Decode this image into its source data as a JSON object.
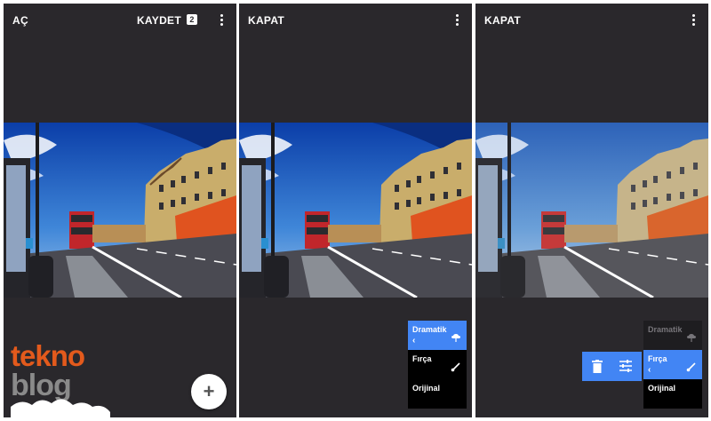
{
  "panels": [
    {
      "left_label": "AÇ",
      "save_label": "KAYDET",
      "badge": "2",
      "more_icon": "more-vert-icon",
      "fab_label": "+",
      "watermark": {
        "line1": "tekno",
        "line2": "blog"
      }
    },
    {
      "left_label": "KAPAT",
      "more_icon": "more-vert-icon",
      "stack": [
        {
          "label": "Dramatik",
          "arrow": "‹",
          "icon": "cloud-icon",
          "style": "blue"
        },
        {
          "label": "Fırça",
          "icon": "brush-icon",
          "style": "black"
        },
        {
          "label": "Orijinal",
          "style": "black"
        }
      ]
    },
    {
      "left_label": "KAPAT",
      "more_icon": "more-vert-icon",
      "stack": [
        {
          "label": "Dramatik",
          "icon": "cloud-icon",
          "style": "faded"
        },
        {
          "label": "Fırça",
          "arrow": "‹",
          "icon": "brush-icon",
          "style": "blue"
        },
        {
          "label": "Orijinal",
          "style": "black"
        }
      ],
      "actions": [
        "delete-icon",
        "adjust-icon"
      ]
    }
  ],
  "colors": {
    "panel_bg": "#2a282c",
    "accent": "#4285f4",
    "watermark_orange": "#e35a1c"
  }
}
